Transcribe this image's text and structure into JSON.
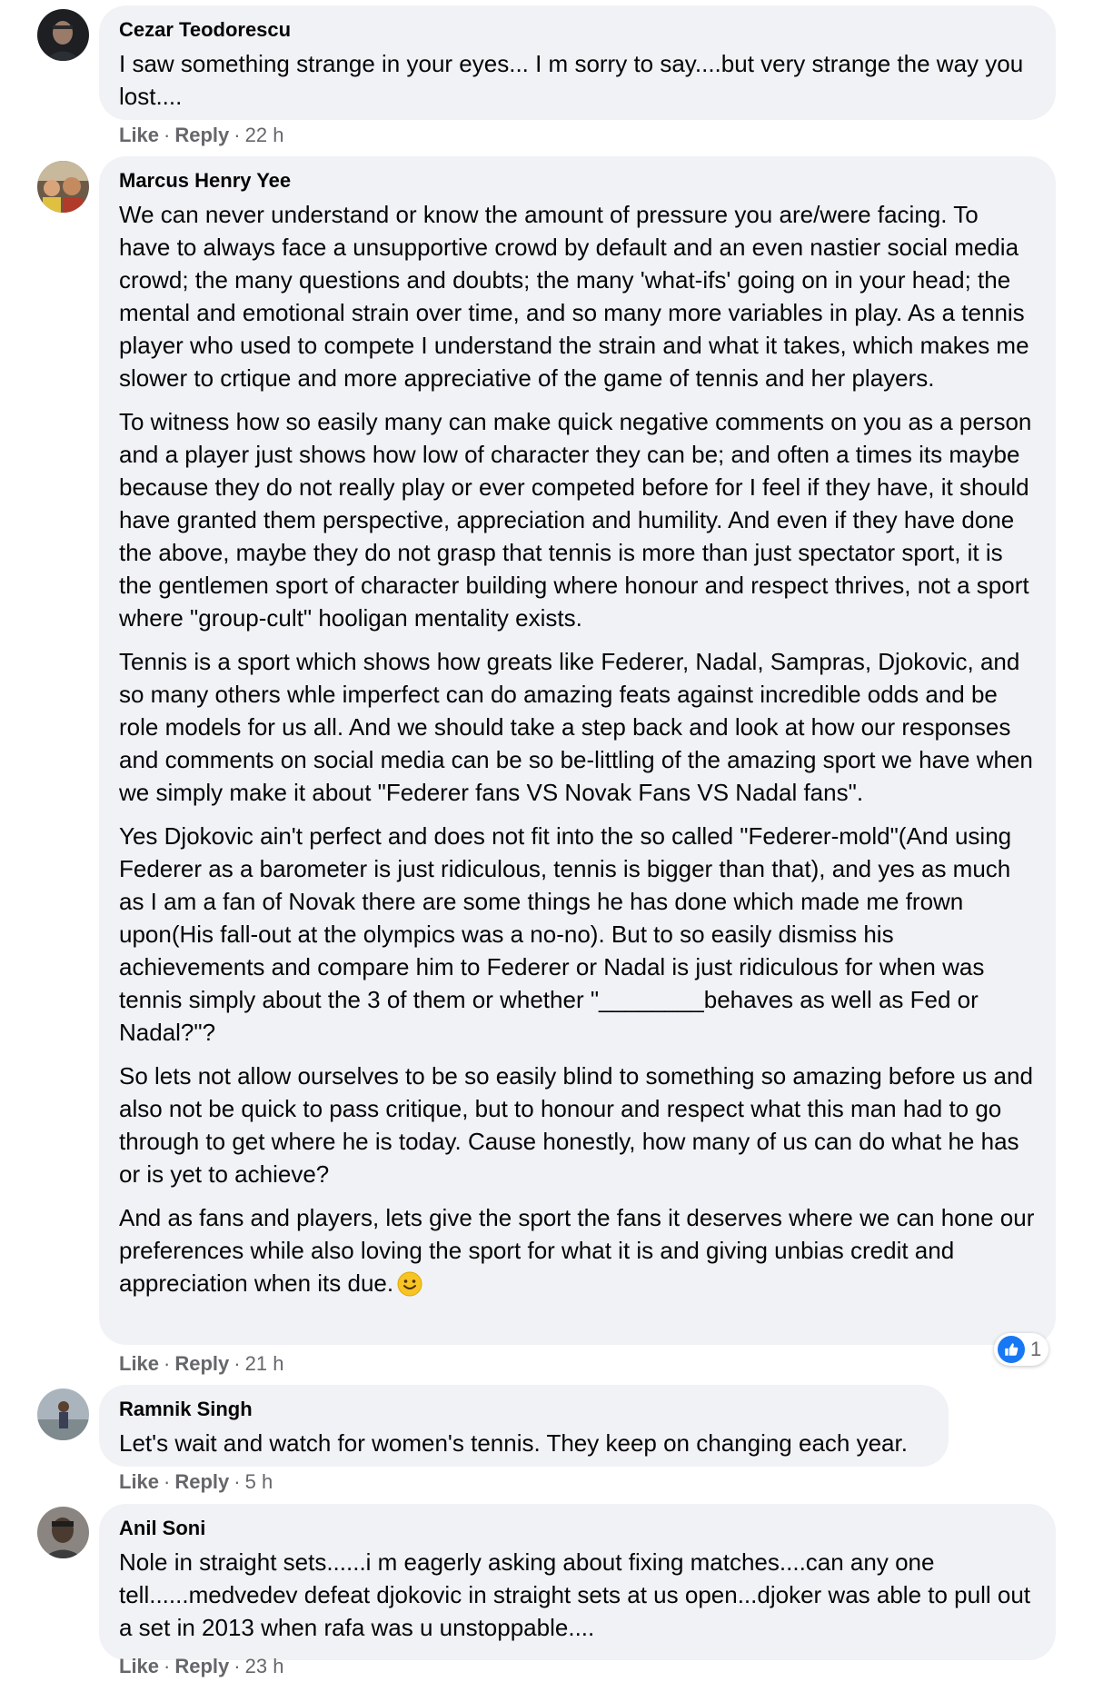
{
  "comments": [
    {
      "author": "Cezar Teodorescu",
      "paragraphs": [
        "I saw something strange in your eyes... I m sorry to say....but very strange the way you lost...."
      ],
      "actions": {
        "like": "Like",
        "reply": "Reply",
        "time": "22 h"
      }
    },
    {
      "author": "Marcus Henry Yee",
      "paragraphs": [
        "We can never understand or know the amount of pressure you are/were facing. To have to always face a unsupportive crowd by default and an even nastier social media crowd; the many questions and doubts; the many 'what-ifs' going on in your head; the mental and emotional strain over time, and so many more variables in play. As a tennis player who used to compete I understand the strain and what it takes, which makes me slower to crtique and more appreciative of the game of tennis and her players.",
        "To witness how so easily many can make quick negative comments on you as a person and a player just shows how low of character they can be; and often a times its maybe because they do not really play or ever competed before for I feel if they have, it should have granted them perspective, appreciation and humility. And even if they have done the above, maybe they do not grasp that tennis is more than just spectator sport, it is the gentlemen sport of character building where honour and respect thrives, not a sport where \"group-cult\" hooligan mentality exists.",
        "Tennis is a sport which shows how greats like Federer, Nadal, Sampras, Djokovic, and so many others whle imperfect can do amazing feats against incredible odds and be role models for us all. And we should take a step back and look at how our responses and comments on social media can be so be-littling of the amazing sport we have when we simply make it about \"Federer fans VS Novak Fans VS Nadal fans\".",
        "Yes Djokovic ain't perfect and does not fit into the so called \"Federer-mold\"(And using Federer as a barometer is just ridiculous, tennis is bigger than that), and yes as much as I am a fan of Novak there are some things he has done which made me frown upon(His fall-out at the olympics was a no-no). But to so easily dismiss his achievements and compare him to Federer or Nadal is just ridiculous for when was tennis simply about the 3 of them or whether \"________behaves as well as Fed or Nadal?\"?",
        "So lets not allow ourselves to be so easily blind to something so amazing before us and also not be quick to pass critique, but to honour and respect what this man had to go through to get where he is today. Cause honestly, how many of us can do what he has or is yet to achieve?",
        "And as fans and players, lets give the sport the fans it deserves where we can hone our preferences while also loving the sport for what it is and giving unbias credit and appreciation when its due."
      ],
      "actions": {
        "like": "Like",
        "reply": "Reply",
        "time": "21 h"
      },
      "reaction_count": "1"
    },
    {
      "author": "Ramnik Singh",
      "paragraphs": [
        "Let's wait and watch for women's tennis. They keep on changing each year."
      ],
      "actions": {
        "like": "Like",
        "reply": "Reply",
        "time": "5 h"
      }
    },
    {
      "author": "Anil Soni",
      "paragraphs": [
        "Nole in straight sets......i m eagerly asking about fixing matches....can any one tell......medvedev defeat djokovic in straight sets at us open...djoker was able to pull out a set in 2013 when rafa was u unstoppable...."
      ],
      "actions": {
        "like": "Like",
        "reply": "Reply",
        "time": "23 h"
      }
    }
  ],
  "separator": "·",
  "colors": {
    "bubble": "#f0f2f5",
    "meta": "#65676b",
    "like_blue": "#1877f2",
    "text": "#050505"
  }
}
